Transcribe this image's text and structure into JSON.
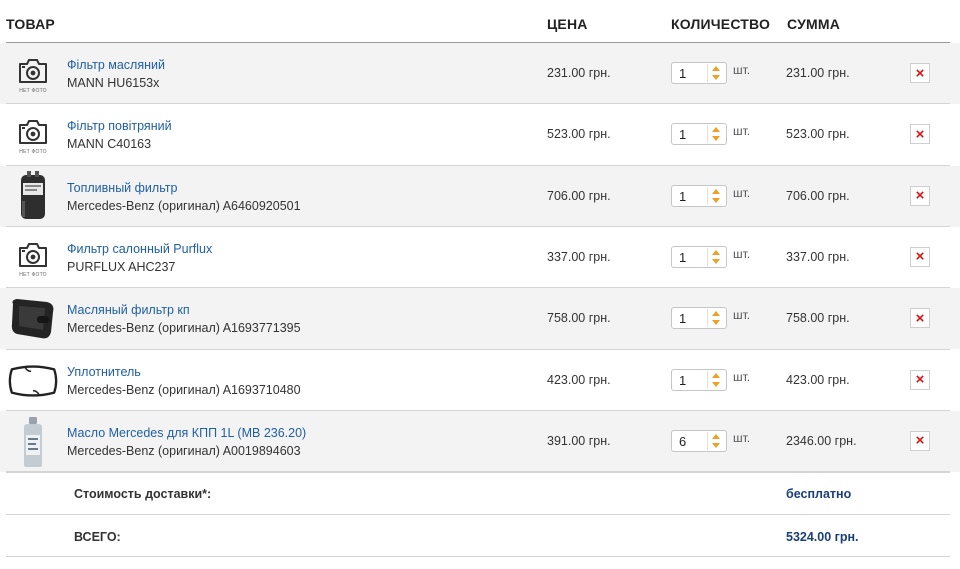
{
  "header": {
    "product": "ТОВАР",
    "price": "ЦЕНА",
    "quantity": "КОЛИЧЕСТВО",
    "sum": "СУММА"
  },
  "no_photo_label": "НЕТ ФОТО",
  "items": [
    {
      "name": "Фільтр масляний",
      "code": "MANN HU6153x",
      "price": "231.00 грн.",
      "qty": "1",
      "unit": "шт.",
      "sum": "231.00 грн.",
      "image": "no-photo"
    },
    {
      "name": "Фільтр повітряний",
      "code": "MANN C40163",
      "price": "523.00 грн.",
      "qty": "1",
      "unit": "шт.",
      "sum": "523.00 грн.",
      "image": "no-photo"
    },
    {
      "name": "Топливный фильтр",
      "code": "Mercedes-Benz (оригинал) A6460920501",
      "price": "706.00 грн.",
      "qty": "1",
      "unit": "шт.",
      "sum": "706.00 грн.",
      "image": "fuel-filter"
    },
    {
      "name": "Фильтр салонный Purflux",
      "code": "PURFLUX AHC237",
      "price": "337.00 грн.",
      "qty": "1",
      "unit": "шт.",
      "sum": "337.00 грн.",
      "image": "no-photo"
    },
    {
      "name": "Масляный фильтр кп",
      "code": "Mercedes-Benz (оригинал) A1693771395",
      "price": "758.00 грн.",
      "qty": "1",
      "unit": "шт.",
      "sum": "758.00 грн.",
      "image": "transmission-filter"
    },
    {
      "name": "Уплотнитель",
      "code": "Mercedes-Benz (оригинал) A1693710480",
      "price": "423.00 грн.",
      "qty": "1",
      "unit": "шт.",
      "sum": "423.00 грн.",
      "image": "gasket"
    },
    {
      "name": "Масло Mercedes для КПП 1L (MB 236.20)",
      "code": "Mercedes-Benz (оригинал) A0019894603",
      "price": "391.00 грн.",
      "qty": "6",
      "unit": "шт.",
      "sum": "2346.00 грн.",
      "image": "oil-bottle"
    }
  ],
  "delivery": {
    "label": "Стоимость доставки*:",
    "value": "бесплатно"
  },
  "total": {
    "label": "ВСЕГО:",
    "value": "5324.00 грн."
  },
  "colors": {
    "link": "#1f5fa6",
    "delete": "#dd1111",
    "spinner": "#f0a020",
    "total": "#1a3e78"
  }
}
